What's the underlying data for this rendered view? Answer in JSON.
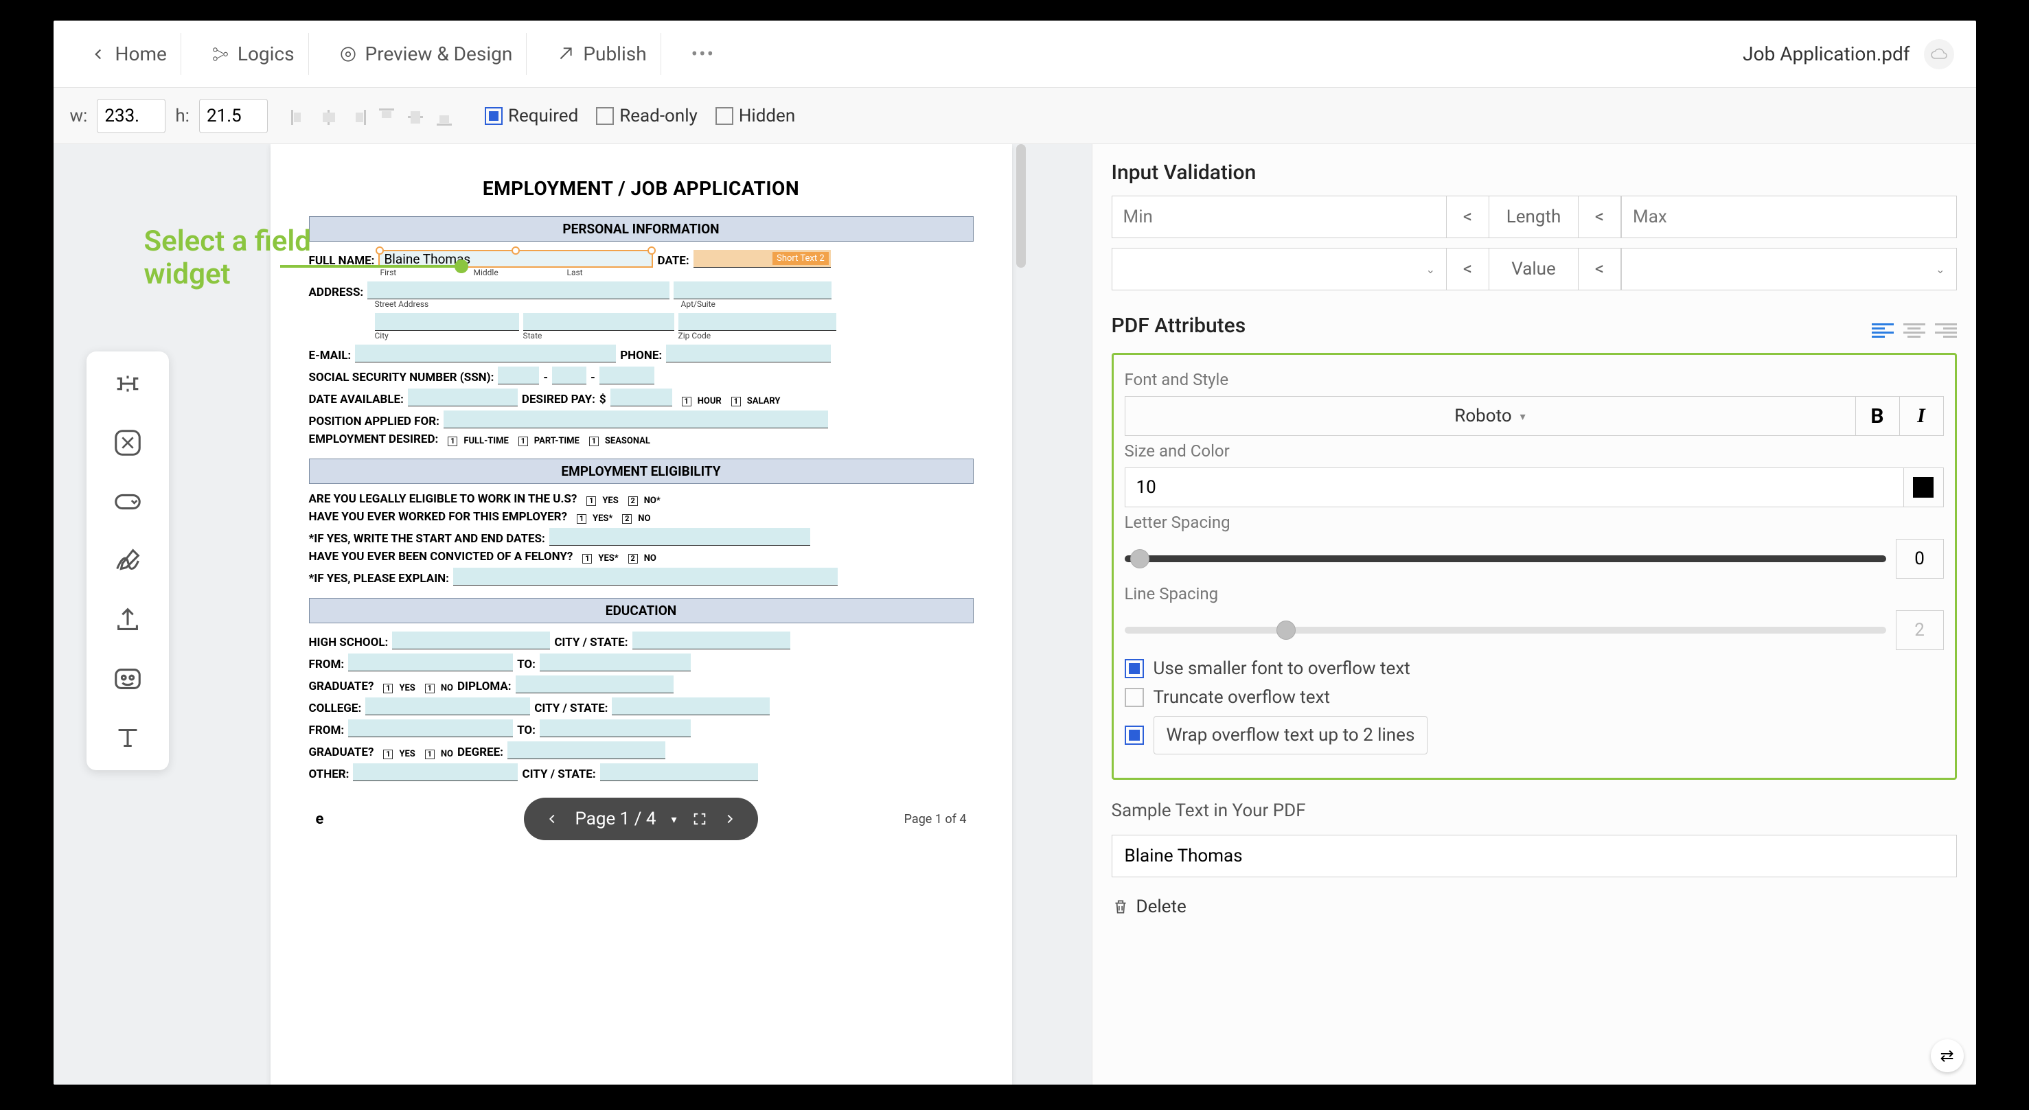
{
  "topnav": {
    "home": "Home",
    "logics": "Logics",
    "preview": "Preview & Design",
    "publish": "Publish",
    "filename": "Job Application.pdf"
  },
  "secbar": {
    "w_label": "w:",
    "w_value": "233.",
    "h_label": "h:",
    "h_value": "21.5",
    "required": "Required",
    "readonly": "Read-only",
    "hidden": "Hidden"
  },
  "select_widget_label": "Select a field\nwidget",
  "doc": {
    "title": "EMPLOYMENT / JOB APPLICATION",
    "sections": {
      "personal": "PERSONAL INFORMATION",
      "eligibility": "EMPLOYMENT ELIGIBILITY",
      "education": "EDUCATION"
    },
    "labels": {
      "fullname": "FULL NAME:",
      "date": "DATE:",
      "first": "First",
      "middle": "Middle",
      "last": "Last",
      "address": "ADDRESS:",
      "street": "Street Address",
      "apt": "Apt/Suite",
      "city": "City",
      "state": "State",
      "zip": "Zip Code",
      "email": "E-MAIL:",
      "phone": "PHONE:",
      "ssn": "SOCIAL SECURITY NUMBER (SSN):",
      "dateavail": "DATE AVAILABLE:",
      "desiredpay": "DESIRED PAY:",
      "dollar": "$",
      "hour": "HOUR",
      "salary": "SALARY",
      "position": "POSITION APPLIED FOR:",
      "empdesired": "EMPLOYMENT DESIRED:",
      "fulltime": "FULL-TIME",
      "parttime": "PART-TIME",
      "seasonal": "SEASONAL",
      "eligible": "ARE YOU LEGALLY ELIGIBLE TO WORK IN THE U.S?",
      "yes": "YES",
      "no": "NO",
      "nostar": "NO*",
      "yesstar": "YES*",
      "worked": "HAVE YOU EVER WORKED FOR THIS EMPLOYER?",
      "ifyes_dates": "*IF YES, WRITE THE START AND END DATES:",
      "felony": "HAVE YOU EVER BEEN CONVICTED OF A FELONY?",
      "ifyes_explain": "*IF YES, PLEASE EXPLAIN:",
      "highschool": "HIGH SCHOOL:",
      "citystate": "CITY / STATE:",
      "from": "FROM:",
      "to": "TO:",
      "graduate": "GRADUATE?",
      "diploma": "DIPLOMA:",
      "college": "COLLEGE:",
      "degree": "DEGREE:",
      "other": "OTHER:"
    },
    "field_value": "Blaine Thomas",
    "field_tag": "Short Text 2",
    "pagenav": "Page 1 / 4",
    "page_of": "Page 1 of 4"
  },
  "rpanel": {
    "validation_h": "Input Validation",
    "min_ph": "Min",
    "max_ph": "Max",
    "lt": "<",
    "length": "Length",
    "value": "Value",
    "pdf_h": "PDF Attributes",
    "font_style": "Font and Style",
    "font": "Roboto",
    "size_color": "Size and Color",
    "size_val": "10",
    "letter_spacing": "Letter Spacing",
    "ls_val": "0",
    "line_spacing": "Line Spacing",
    "line_val": "2",
    "smaller": "Use smaller font to overflow text",
    "truncate": "Truncate overflow text",
    "wrap": "Wrap overflow text up to 2 lines",
    "sample_h": "Sample Text in Your PDF",
    "sample_val": "Blaine Thomas",
    "delete": "Delete"
  }
}
